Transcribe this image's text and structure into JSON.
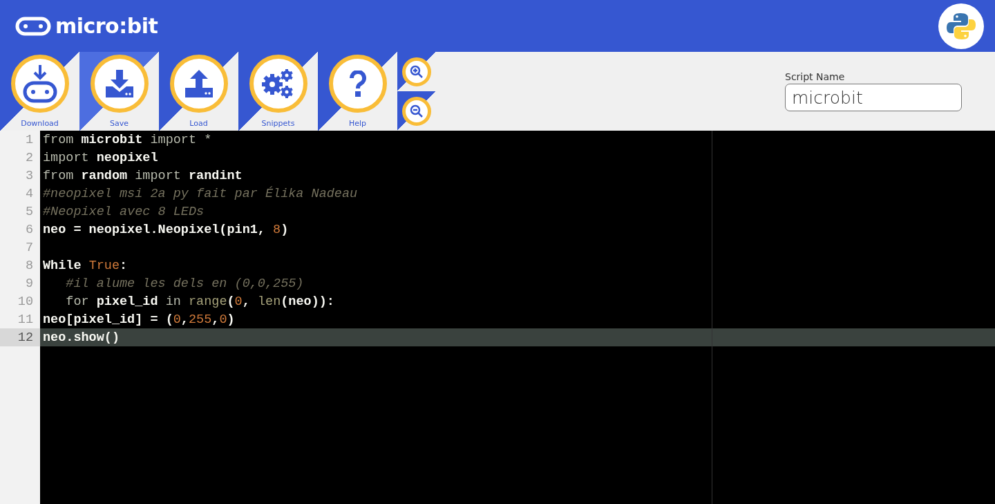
{
  "header": {
    "brand": "micro:bit"
  },
  "toolbar": {
    "buttons": [
      {
        "kind": "download",
        "label": "Download",
        "selected": false
      },
      {
        "kind": "save",
        "label": "Save",
        "selected": true
      },
      {
        "kind": "load",
        "label": "Load",
        "selected": false
      },
      {
        "kind": "snippets",
        "label": "Snippets",
        "selected": false
      },
      {
        "kind": "help",
        "label": "Help",
        "selected": false
      }
    ],
    "zoom": [
      {
        "kind": "zoom-in"
      },
      {
        "kind": "zoom-out"
      }
    ]
  },
  "script_name": {
    "label": "Script Name",
    "value": "microbit"
  },
  "editor": {
    "lines": [
      {
        "number": "1",
        "current": false,
        "tokens": [
          {
            "kind": "keyword",
            "text": "from "
          },
          {
            "kind": "name",
            "text": "microbit"
          },
          {
            "kind": "keyword",
            "text": " import *"
          }
        ]
      },
      {
        "number": "2",
        "current": false,
        "tokens": [
          {
            "kind": "keyword",
            "text": "import "
          },
          {
            "kind": "name",
            "text": "neopixel"
          }
        ]
      },
      {
        "number": "3",
        "current": false,
        "tokens": [
          {
            "kind": "keyword",
            "text": "from "
          },
          {
            "kind": "name",
            "text": "random"
          },
          {
            "kind": "keyword",
            "text": " import "
          },
          {
            "kind": "name",
            "text": "randint"
          }
        ]
      },
      {
        "number": "4",
        "current": false,
        "tokens": [
          {
            "kind": "comment",
            "text": "#neopixel msi 2a py fait par Élika Nadeau"
          }
        ]
      },
      {
        "number": "5",
        "current": false,
        "tokens": [
          {
            "kind": "comment",
            "text": "#Neopixel avec 8 LEDs"
          }
        ]
      },
      {
        "number": "6",
        "current": false,
        "tokens": [
          {
            "kind": "name",
            "text": "neo = neopixel.Neopixel(pin1, "
          },
          {
            "kind": "number",
            "text": "8"
          },
          {
            "kind": "name",
            "text": ")"
          }
        ]
      },
      {
        "number": "7",
        "current": false
      },
      {
        "number": "8",
        "current": false,
        "tokens": [
          {
            "kind": "name",
            "text": "While "
          },
          {
            "kind": "number",
            "text": "True"
          },
          {
            "kind": "name",
            "text": ":"
          }
        ]
      },
      {
        "number": "9",
        "current": false,
        "tokens": [
          {
            "kind": "comment",
            "text": "   #il alume les dels en (0,0,255)"
          }
        ]
      },
      {
        "number": "10",
        "current": false,
        "tokens": [
          {
            "kind": "keyword",
            "text": "   for "
          },
          {
            "kind": "name",
            "text": "pixel_id"
          },
          {
            "kind": "keyword",
            "text": " in "
          },
          {
            "kind": "builtin",
            "text": "range"
          },
          {
            "kind": "name",
            "text": "("
          },
          {
            "kind": "number",
            "text": "0"
          },
          {
            "kind": "name",
            "text": ", "
          },
          {
            "kind": "builtin",
            "text": "len"
          },
          {
            "kind": "name",
            "text": "(neo)):"
          }
        ]
      },
      {
        "number": "11",
        "current": false,
        "tokens": [
          {
            "kind": "name",
            "text": "neo[pixel_id] = ("
          },
          {
            "kind": "number",
            "text": "0"
          },
          {
            "kind": "name",
            "text": ","
          },
          {
            "kind": "number",
            "text": "255"
          },
          {
            "kind": "name",
            "text": ","
          },
          {
            "kind": "number",
            "text": "0"
          },
          {
            "kind": "name",
            "text": ")"
          }
        ]
      },
      {
        "number": "12",
        "current": true,
        "tokens": [
          {
            "kind": "name",
            "text": "neo.show()"
          }
        ]
      }
    ]
  }
}
